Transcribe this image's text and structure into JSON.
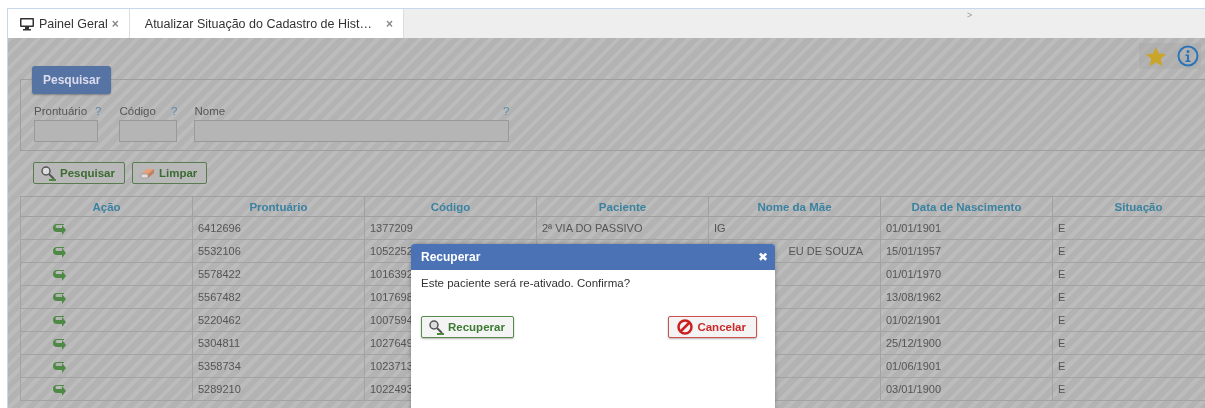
{
  "tabs": [
    {
      "label": "Painel Geral",
      "close": "×",
      "selected": true
    },
    {
      "label": "Atualizar Situação do Cadastro de Hist…",
      "close": "×",
      "selected": true
    }
  ],
  "tab_scroll": ">",
  "search_panel": {
    "legend": "Pesquisar",
    "fields": [
      {
        "label": "Prontuário",
        "help": "?"
      },
      {
        "label": "Código",
        "help": "?"
      },
      {
        "label": "Nome",
        "help": "?"
      }
    ],
    "buttons": [
      {
        "label": "Pesquisar",
        "kind": "search"
      },
      {
        "label": "Limpar",
        "kind": "clear"
      }
    ]
  },
  "table": {
    "columns": [
      "Ação",
      "Prontuário",
      "Código",
      "Paciente",
      "Nome da Mãe",
      "Data de Nascimento",
      "Situação"
    ],
    "rows": [
      {
        "cells": [
          "",
          "6412696",
          "1377209",
          "2ª VIA DO PASSIVO",
          "IG",
          "01/01/1901",
          "E"
        ]
      },
      {
        "cells": [
          "",
          "5532106",
          "1052252",
          "",
          {
            "text": "EU DE SOUZA",
            "covered": true
          },
          "15/01/1957",
          "E"
        ]
      },
      {
        "cells": [
          "",
          "5578422",
          "1016392",
          "",
          "",
          "01/01/1970",
          "E"
        ]
      },
      {
        "cells": [
          "",
          "5567482",
          "1017698",
          "",
          "",
          "13/08/1962",
          "E"
        ]
      },
      {
        "cells": [
          "",
          "5220462",
          "1007594",
          "",
          "",
          "01/02/1901",
          "E"
        ]
      },
      {
        "cells": [
          "",
          "5304811",
          "1027649",
          "",
          "",
          "25/12/1900",
          "E"
        ]
      },
      {
        "cells": [
          "",
          "5358734",
          "1023713",
          "",
          "",
          "01/06/1901",
          "E"
        ]
      },
      {
        "cells": [
          "",
          "5289210",
          "1022493",
          "",
          "",
          "03/01/1900",
          "E"
        ]
      }
    ]
  },
  "dialog": {
    "title": "Recuperar",
    "close": "✖",
    "message": "Este paciente será re-ativado. Confirma?",
    "buttons": [
      {
        "label": "Recuperar",
        "kind": "confirm"
      },
      {
        "label": "Cancelar",
        "kind": "cancel"
      }
    ]
  }
}
